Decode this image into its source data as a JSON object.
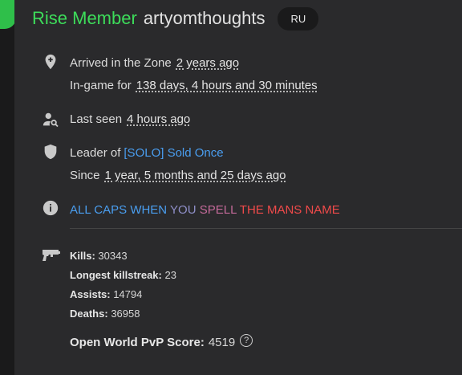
{
  "header": {
    "rank": "Rise Member",
    "username": "artyomthoughts",
    "region": "RU"
  },
  "arrival": {
    "label": "Arrived in the Zone",
    "value": "2 years ago",
    "ingame_label": "In-game for",
    "ingame_value": "138 days, 4 hours and 30 minutes"
  },
  "last_seen": {
    "label": "Last seen",
    "value": "4 hours ago"
  },
  "clan": {
    "label": "Leader of",
    "name": "[SOLO] Sold Once",
    "since_label": "Since",
    "since_value": "1 year, 5 months and 25 days ago"
  },
  "status": {
    "segments": [
      {
        "text": "ALL CAPS WHEN ",
        "color": "#4a9ef0"
      },
      {
        "text": "YOU ",
        "color": "#8f8fc8"
      },
      {
        "text": "SPELL ",
        "color": "#c46a9a"
      },
      {
        "text": "THE MANS NAME",
        "color": "#f04a4a"
      }
    ]
  },
  "stats": {
    "kills_label": "Kills:",
    "kills": "30343",
    "killstreak_label": "Longest killstreak:",
    "killstreak": "23",
    "assists_label": "Assists:",
    "assists": "14794",
    "deaths_label": "Deaths:",
    "deaths": "36958",
    "pvp_label": "Open World PvP Score:",
    "pvp": "4519",
    "help_icon": "?"
  },
  "colors": {
    "rank": "#3ddc5a",
    "link": "#4a9ef0",
    "background": "#2a2a2c"
  }
}
